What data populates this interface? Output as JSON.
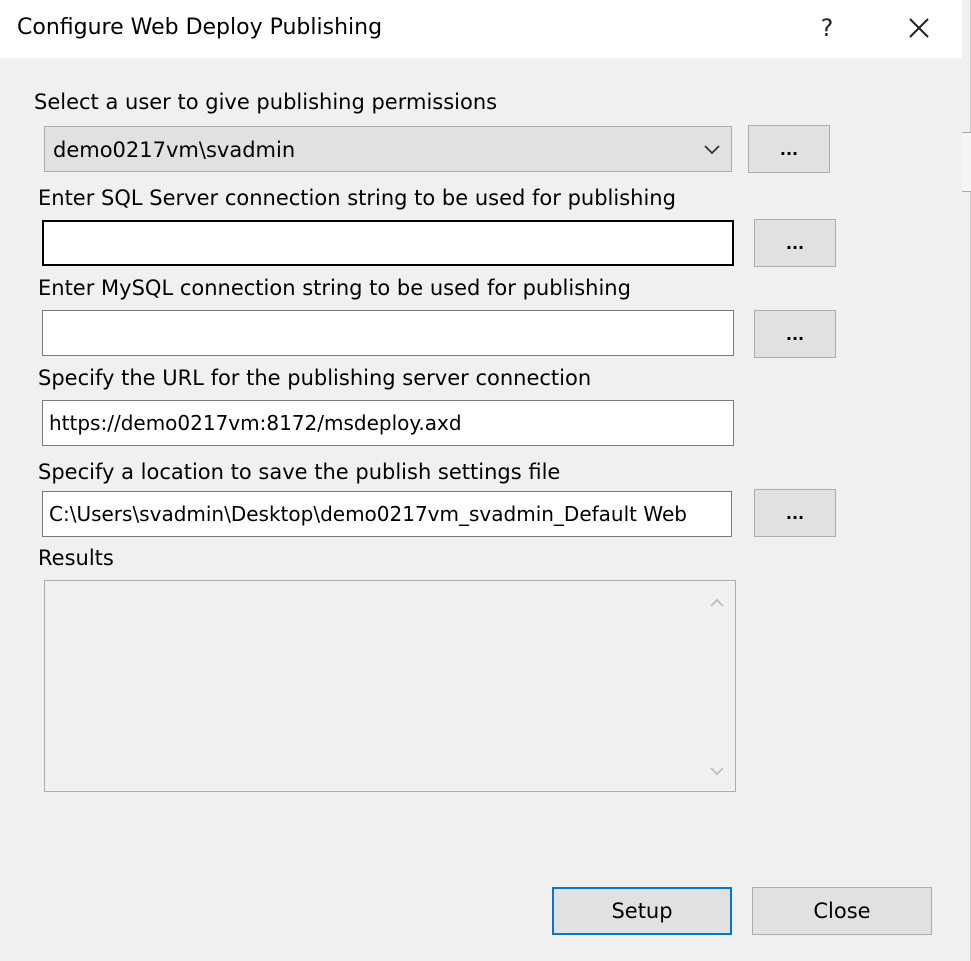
{
  "window": {
    "title": "Configure Web Deploy Publishing",
    "help_label": "?",
    "close_icon": "close-icon"
  },
  "user": {
    "label": "Select a user to give publishing permissions",
    "selected": "demo0217vm\\svadmin",
    "browse_label": "..."
  },
  "sql": {
    "label": "Enter SQL Server connection string to be used for publishing",
    "value": "",
    "browse_label": "..."
  },
  "mysql": {
    "label": "Enter MySQL connection string to be used for publishing",
    "value": "",
    "browse_label": "..."
  },
  "url": {
    "label": "Specify the URL for the publishing server connection",
    "value": "https://demo0217vm:8172/msdeploy.axd"
  },
  "location": {
    "label": "Specify a location to save the publish settings file",
    "value": "C:\\Users\\svadmin\\Desktop\\demo0217vm_svadmin_Default Web",
    "browse_label": "..."
  },
  "results": {
    "label": "Results",
    "content": ""
  },
  "buttons": {
    "setup": "Setup",
    "close": "Close"
  },
  "colors": {
    "dialog_bg": "#f0f0f0",
    "button_bg": "#e1e1e1",
    "default_border": "#0078d7"
  }
}
